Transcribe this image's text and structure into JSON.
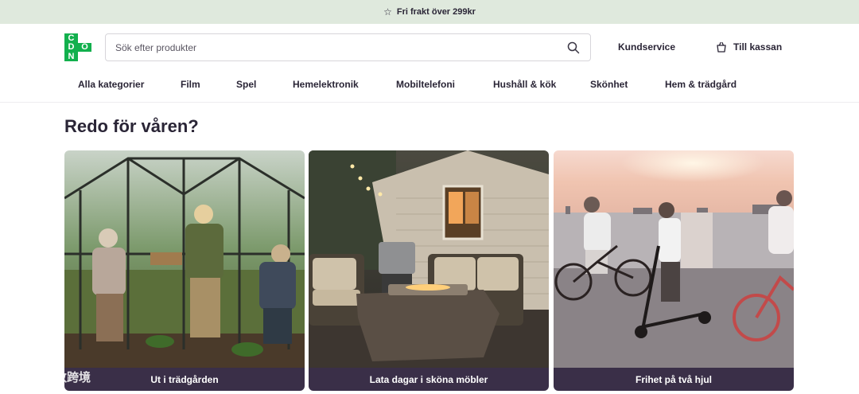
{
  "promo": {
    "text": "Fri frakt över 299kr",
    "icon": "star-icon"
  },
  "logo": {
    "letters": [
      "C",
      "D",
      "O",
      "N"
    ]
  },
  "search": {
    "placeholder": "Sök efter produkter",
    "value": "",
    "icon": "search-icon"
  },
  "header": {
    "customer_service": "Kundservice",
    "checkout": "Till kassan",
    "checkout_icon": "shopping-bag-icon"
  },
  "nav": {
    "items": [
      {
        "label": "Alla kategorier"
      },
      {
        "label": "Film"
      },
      {
        "label": "Spel"
      },
      {
        "label": "Hemelektronik"
      },
      {
        "label": "Mobiltelefoni"
      },
      {
        "label": "Hushåll & kök"
      },
      {
        "label": "Skönhet"
      },
      {
        "label": "Hem & trädgård"
      }
    ]
  },
  "section": {
    "title": "Redo för våren?"
  },
  "cards": [
    {
      "caption": "Ut i trädgården"
    },
    {
      "caption": "Lata dagar i sköna möbler"
    },
    {
      "caption": "Frihet på två hjul"
    }
  ],
  "watermark": {
    "text": "大数跨境"
  },
  "colors": {
    "brand_green": "#12b04d",
    "promo_bg": "#dfe9dd",
    "caption_bg": "#3a2f48",
    "text_dark": "#2a2536"
  }
}
